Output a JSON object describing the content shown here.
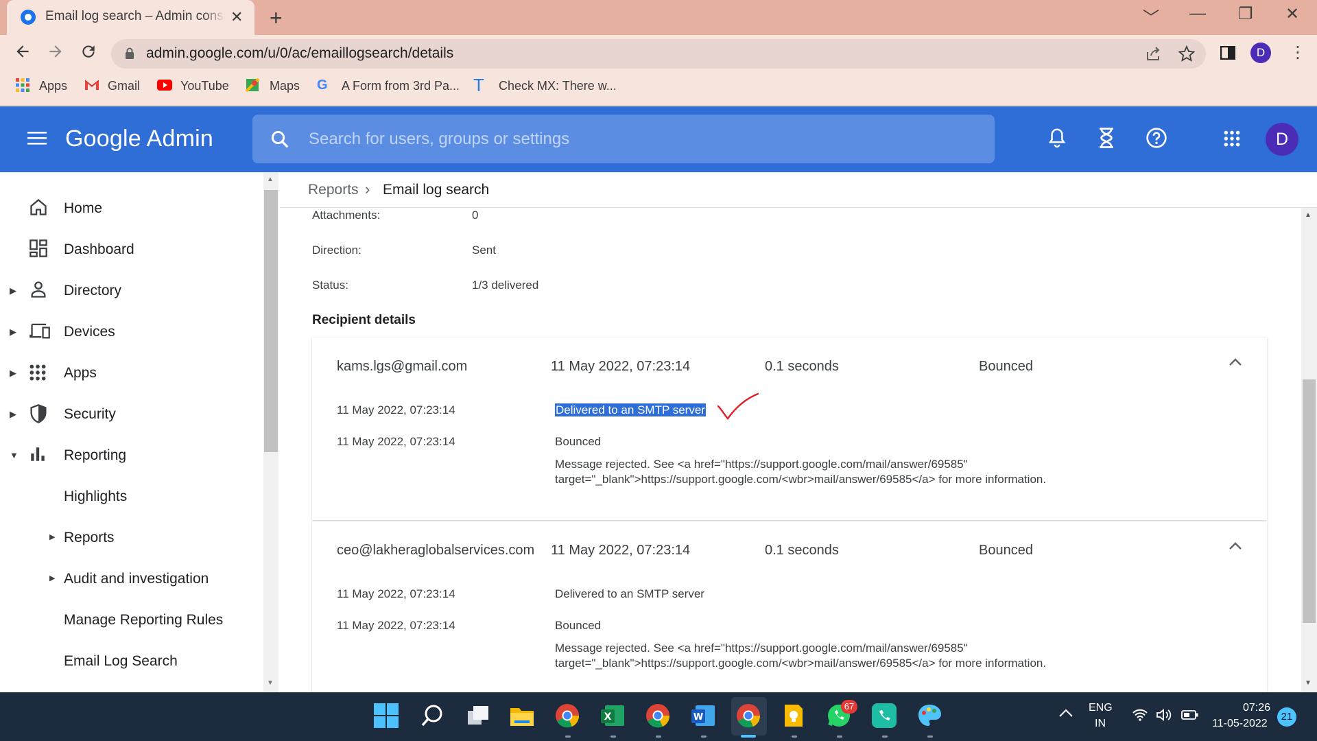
{
  "browser": {
    "tab_title": "Email log search – Admin console",
    "tab_close": "✕",
    "new_tab": "+",
    "window_controls": [
      "﹀",
      "—",
      "❐",
      "✕"
    ],
    "url": "admin.google.com/u/0/ac/emaillogsearch/details",
    "profile_initial": "D",
    "bookmarks": [
      "Apps",
      "Gmail",
      "YouTube",
      "Maps",
      "A Form from 3rd Pa...",
      "Check MX: There w..."
    ]
  },
  "header": {
    "logo": "Google Admin",
    "search_placeholder": "Search for users, groups or settings",
    "avatar_initial": "D"
  },
  "sidebar": {
    "items": [
      {
        "label": "Home",
        "icon": "home-icon"
      },
      {
        "label": "Dashboard",
        "icon": "dashboard-icon"
      },
      {
        "label": "Directory",
        "icon": "person-icon"
      },
      {
        "label": "Devices",
        "icon": "devices-icon"
      },
      {
        "label": "Apps",
        "icon": "apps-grid-icon"
      },
      {
        "label": "Security",
        "icon": "shield-icon"
      },
      {
        "label": "Reporting",
        "icon": "bar-chart-icon"
      },
      {
        "label": "Highlights"
      },
      {
        "label": "Reports"
      },
      {
        "label": "Audit and investigation"
      },
      {
        "label": "Manage Reporting Rules"
      },
      {
        "label": "Email Log Search"
      }
    ]
  },
  "breadcrumb": {
    "parent": "Reports",
    "separator": "›",
    "current": "Email log search"
  },
  "details": [
    {
      "label": "Attachments:",
      "value": "0"
    },
    {
      "label": "Direction:",
      "value": "Sent"
    },
    {
      "label": "Status:",
      "value": "1/3 delivered"
    }
  ],
  "recipient_title": "Recipient details",
  "recipients": [
    {
      "email": "kams.lgs@gmail.com",
      "date": "11 May 2022, 07:23:14",
      "duration": "0.1 seconds",
      "status": "Bounced",
      "events": [
        {
          "time": "11 May 2022, 07:23:14",
          "text": "Delivered to an SMTP server"
        },
        {
          "time": "11 May 2022, 07:23:14",
          "text": "Bounced"
        }
      ],
      "message_line1": "Message rejected. See <a href=\"https://support.google.com/mail/answer/69585\"",
      "message_line2": "target=\"_blank\">https://support.google.com/<wbr>mail/answer/69585</a> for more information."
    },
    {
      "email": "ceo@lakheraglobalservices.com",
      "date": "11 May 2022, 07:23:14",
      "duration": "0.1 seconds",
      "status": "Bounced",
      "events": [
        {
          "time": "11 May 2022, 07:23:14",
          "text": "Delivered to an SMTP server"
        },
        {
          "time": "11 May 2022, 07:23:14",
          "text": "Bounced"
        }
      ],
      "message_line1": "Message rejected. See <a href=\"https://support.google.com/mail/answer/69585\"",
      "message_line2": "target=\"_blank\">https://support.google.com/<wbr>mail/answer/69585</a> for more information."
    }
  ],
  "taskbar": {
    "whatsapp_badge": "67",
    "lang_top": "ENG",
    "lang_bottom": "IN",
    "time": "07:26",
    "date": "11-05-2022",
    "notif_count": "21"
  },
  "colors": {
    "admin_blue": "#2e6ed6",
    "tab_bar": "#e6b0a0",
    "taskbar": "#1c2b3e",
    "checkmark_red": "#e0202a"
  }
}
